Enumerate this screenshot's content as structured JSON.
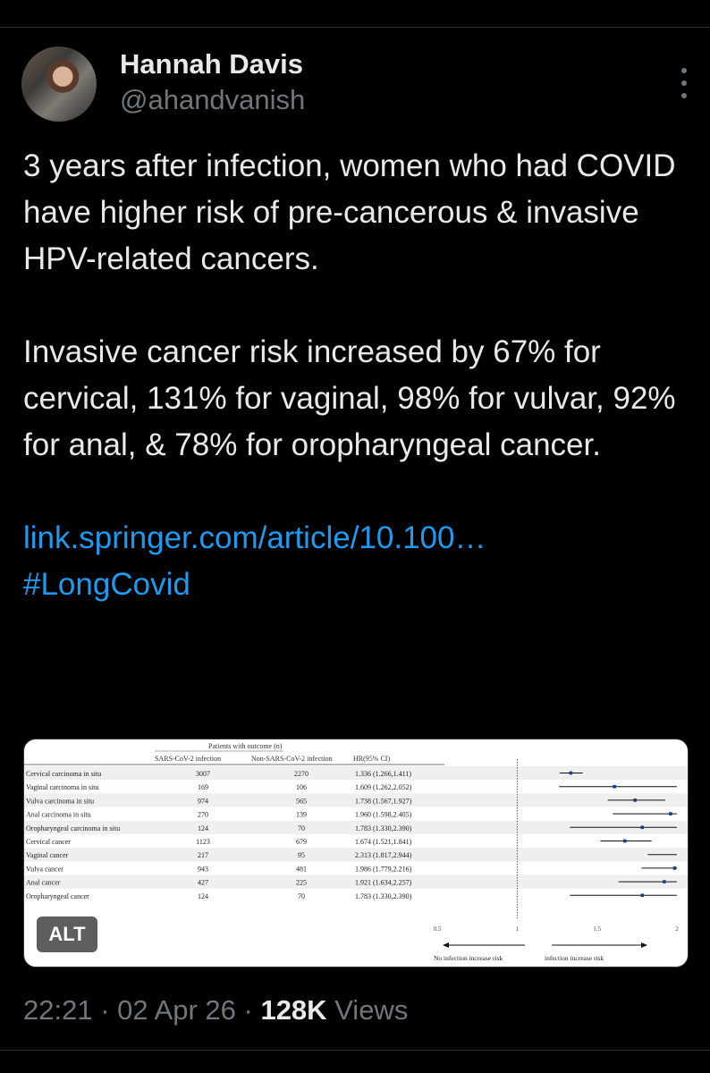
{
  "author": {
    "display_name": "Hannah Davis",
    "handle": "@ahandvanish"
  },
  "tweet": {
    "paragraph1": "3 years after infection, women who had COVID have higher risk of pre-cancerous & invasive HPV-related cancers.",
    "paragraph2": "Invasive cancer risk increased by 67% for cervical, 131% for vaginal, 98% for vulvar, 92% for anal, & 78% for oropharyngeal cancer.",
    "link": "link.springer.com/article/10.100…",
    "hashtag": "#LongCovid"
  },
  "media": {
    "alt_badge": "ALT",
    "table": {
      "group_header": "Patients with outcome (n)",
      "col_headers": [
        "SARS-CoV-2 infection",
        "Non-SARS-CoV-2 infection",
        "HR(95% CI)"
      ],
      "rows": [
        {
          "label": "Cervical carcinoma in situ",
          "infected": "3007",
          "non_infected": "2270",
          "hr_text": "1.336 (1.266,1.411)",
          "hr": 1.336,
          "lo": 1.266,
          "hi": 1.411
        },
        {
          "label": "Vaginal carcinoma in situ",
          "infected": "169",
          "non_infected": "106",
          "hr_text": "1.609 (1.262,2.052)",
          "hr": 1.609,
          "lo": 1.262,
          "hi": 2.052
        },
        {
          "label": "Vulva carcinoma in situ",
          "infected": "974",
          "non_infected": "565",
          "hr_text": "1.738 (1.567,1.927)",
          "hr": 1.738,
          "lo": 1.567,
          "hi": 1.927
        },
        {
          "label": "Anal carcinoma in situ",
          "infected": "270",
          "non_infected": "139",
          "hr_text": "1.960 (1.598,2.405)",
          "hr": 1.96,
          "lo": 1.598,
          "hi": 2.405
        },
        {
          "label": "Oropharyngeal carcinoma in situ",
          "infected": "124",
          "non_infected": "70",
          "hr_text": "1.783 (1.330,2.390)",
          "hr": 1.783,
          "lo": 1.33,
          "hi": 2.39
        },
        {
          "label": "Cervical cancer",
          "infected": "1123",
          "non_infected": "679",
          "hr_text": "1.674 (1.521,1.841)",
          "hr": 1.674,
          "lo": 1.521,
          "hi": 1.841
        },
        {
          "label": "Vaginal cancer",
          "infected": "217",
          "non_infected": "95",
          "hr_text": "2.313 (1.817,2.944)",
          "hr": 2.313,
          "lo": 1.817,
          "hi": 2.944
        },
        {
          "label": "Vulva cancer",
          "infected": "943",
          "non_infected": "481",
          "hr_text": "1.986 (1.779,2.216)",
          "hr": 1.986,
          "lo": 1.779,
          "hi": 2.216
        },
        {
          "label": "Anal cancer",
          "infected": "427",
          "non_infected": "225",
          "hr_text": "1.921 (1.634,2.257)",
          "hr": 1.921,
          "lo": 1.634,
          "hi": 2.257
        },
        {
          "label": "Oropharyngeal cancer",
          "infected": "124",
          "non_infected": "70",
          "hr_text": "1.783 (1.330,2.390)",
          "hr": 1.783,
          "lo": 1.33,
          "hi": 2.39
        }
      ],
      "axis": {
        "ticks": [
          0.5,
          1,
          1.5,
          2
        ],
        "tick_labels": [
          "0.5",
          "1",
          "1.5",
          "2"
        ],
        "min": 0.5,
        "max": 2,
        "left_label": "No infection increase risk",
        "right_label": "infection increase risk"
      }
    }
  },
  "meta": {
    "time": "22:21",
    "separator": "·",
    "date": "02 Apr 26",
    "views_count": "128K",
    "views_label": "Views"
  },
  "colors": {
    "background": "#000000",
    "text": "#e7e9ea",
    "muted": "#71767b",
    "link": "#1d9bf0",
    "forest_point": "#1a3a8a"
  }
}
